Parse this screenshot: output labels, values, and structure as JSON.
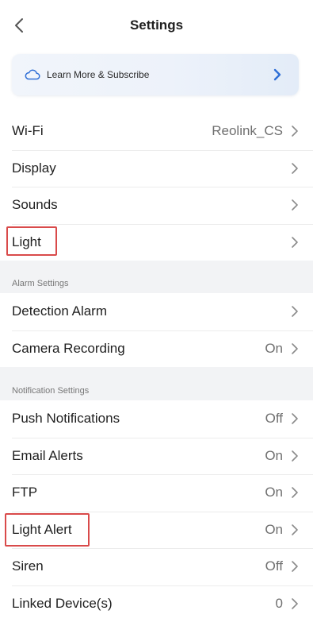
{
  "header": {
    "title": "Settings"
  },
  "banner": {
    "label": "Learn More & Subscribe"
  },
  "general": [
    {
      "name": "Wi-Fi",
      "value": "Reolink_CS"
    },
    {
      "name": "Display",
      "value": ""
    },
    {
      "name": "Sounds",
      "value": ""
    },
    {
      "name": "Light",
      "value": ""
    }
  ],
  "alarm": {
    "label": "Alarm Settings",
    "items": [
      {
        "name": "Detection Alarm",
        "value": ""
      },
      {
        "name": "Camera Recording",
        "value": "On"
      }
    ]
  },
  "notification": {
    "label": "Notification Settings",
    "items": [
      {
        "name": "Push Notifications",
        "value": "Off"
      },
      {
        "name": "Email Alerts",
        "value": "On"
      },
      {
        "name": "FTP",
        "value": "On"
      },
      {
        "name": "Light Alert",
        "value": "On"
      },
      {
        "name": "Siren",
        "value": "Off"
      },
      {
        "name": "Linked Device(s)",
        "value": "0"
      }
    ]
  },
  "colors": {
    "accent": "#2f6fd6",
    "highlight": "#d94a4a",
    "chevron": "#8a8a8a"
  }
}
